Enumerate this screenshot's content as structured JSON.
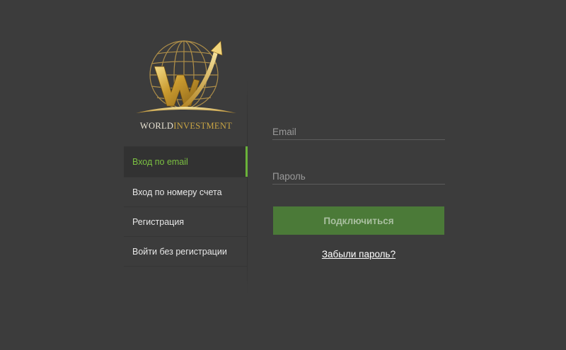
{
  "brand": {
    "logo_icon": "world-investment-globe-w-logo",
    "name_part1": "WORLD",
    "name_part2": "INVESTMENT",
    "gold": "#c9a544"
  },
  "nav": {
    "items": [
      {
        "label": "Вход по email",
        "active": true
      },
      {
        "label": "Вход по номеру счета",
        "active": false
      },
      {
        "label": "Регистрация",
        "active": false
      },
      {
        "label": "Войти без регистрации",
        "active": false
      }
    ],
    "active_color": "#7cc142",
    "indicator_color": "#6ab23a"
  },
  "form": {
    "email_placeholder": "Email",
    "password_placeholder": "Пароль",
    "submit_label": "Подключиться",
    "forgot_label": "Забыли пароль?",
    "button_color": "#4b7a38"
  },
  "colors": {
    "background": "#3c3c3c"
  }
}
